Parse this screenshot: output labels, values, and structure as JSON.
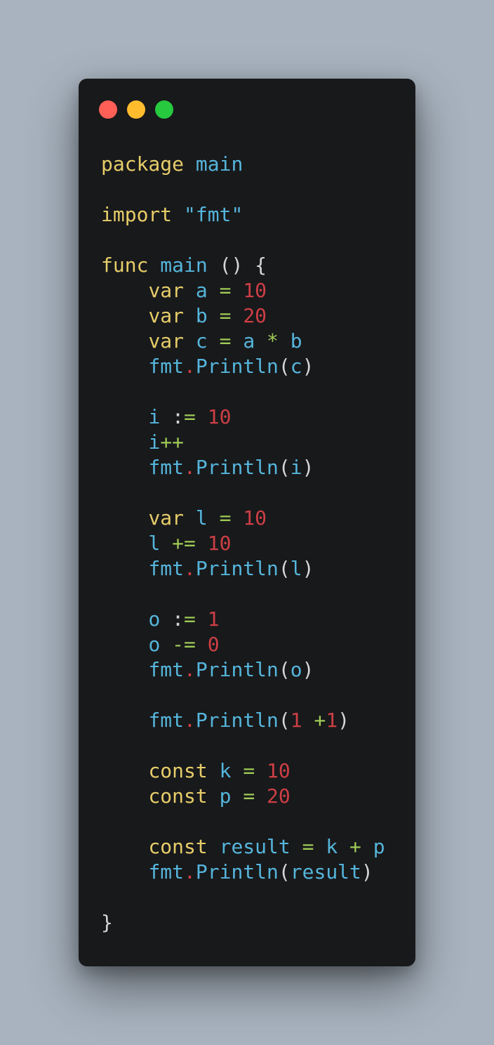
{
  "window": {
    "traffic_lights": [
      {
        "name": "close",
        "color": "#ff5f56"
      },
      {
        "name": "minimize",
        "color": "#ffbd2e"
      },
      {
        "name": "maximize",
        "color": "#27c93f"
      }
    ]
  },
  "code": {
    "language": "go",
    "lines": [
      [
        {
          "t": "package",
          "c": "kw"
        },
        {
          "t": " ",
          "c": "punc"
        },
        {
          "t": "main",
          "c": "id"
        }
      ],
      [],
      [
        {
          "t": "import",
          "c": "kw"
        },
        {
          "t": " ",
          "c": "punc"
        },
        {
          "t": "\"fmt\"",
          "c": "str"
        }
      ],
      [],
      [
        {
          "t": "func",
          "c": "kw"
        },
        {
          "t": " ",
          "c": "punc"
        },
        {
          "t": "main",
          "c": "id"
        },
        {
          "t": " () {",
          "c": "punc"
        }
      ],
      [
        {
          "t": "    ",
          "c": "punc"
        },
        {
          "t": "var",
          "c": "kw"
        },
        {
          "t": " ",
          "c": "punc"
        },
        {
          "t": "a",
          "c": "id"
        },
        {
          "t": " ",
          "c": "punc"
        },
        {
          "t": "=",
          "c": "op"
        },
        {
          "t": " ",
          "c": "punc"
        },
        {
          "t": "10",
          "c": "num"
        }
      ],
      [
        {
          "t": "    ",
          "c": "punc"
        },
        {
          "t": "var",
          "c": "kw"
        },
        {
          "t": " ",
          "c": "punc"
        },
        {
          "t": "b",
          "c": "id"
        },
        {
          "t": " ",
          "c": "punc"
        },
        {
          "t": "=",
          "c": "op"
        },
        {
          "t": " ",
          "c": "punc"
        },
        {
          "t": "20",
          "c": "num"
        }
      ],
      [
        {
          "t": "    ",
          "c": "punc"
        },
        {
          "t": "var",
          "c": "kw"
        },
        {
          "t": " ",
          "c": "punc"
        },
        {
          "t": "c",
          "c": "id"
        },
        {
          "t": " ",
          "c": "punc"
        },
        {
          "t": "=",
          "c": "op"
        },
        {
          "t": " ",
          "c": "punc"
        },
        {
          "t": "a",
          "c": "id"
        },
        {
          "t": " ",
          "c": "punc"
        },
        {
          "t": "*",
          "c": "op"
        },
        {
          "t": " ",
          "c": "punc"
        },
        {
          "t": "b",
          "c": "id"
        }
      ],
      [
        {
          "t": "    ",
          "c": "punc"
        },
        {
          "t": "fmt",
          "c": "id"
        },
        {
          "t": ".",
          "c": "dot-op"
        },
        {
          "t": "Println",
          "c": "id"
        },
        {
          "t": "(",
          "c": "punc"
        },
        {
          "t": "c",
          "c": "id"
        },
        {
          "t": ")",
          "c": "punc"
        }
      ],
      [],
      [
        {
          "t": "    ",
          "c": "punc"
        },
        {
          "t": "i",
          "c": "id"
        },
        {
          "t": " :",
          "c": "punc"
        },
        {
          "t": "=",
          "c": "op"
        },
        {
          "t": " ",
          "c": "punc"
        },
        {
          "t": "10",
          "c": "num"
        }
      ],
      [
        {
          "t": "    ",
          "c": "punc"
        },
        {
          "t": "i",
          "c": "id"
        },
        {
          "t": "++",
          "c": "op"
        }
      ],
      [
        {
          "t": "    ",
          "c": "punc"
        },
        {
          "t": "fmt",
          "c": "id"
        },
        {
          "t": ".",
          "c": "dot-op"
        },
        {
          "t": "Println",
          "c": "id"
        },
        {
          "t": "(",
          "c": "punc"
        },
        {
          "t": "i",
          "c": "id"
        },
        {
          "t": ")",
          "c": "punc"
        }
      ],
      [],
      [
        {
          "t": "    ",
          "c": "punc"
        },
        {
          "t": "var",
          "c": "kw"
        },
        {
          "t": " ",
          "c": "punc"
        },
        {
          "t": "l",
          "c": "id"
        },
        {
          "t": " ",
          "c": "punc"
        },
        {
          "t": "=",
          "c": "op"
        },
        {
          "t": " ",
          "c": "punc"
        },
        {
          "t": "10",
          "c": "num"
        }
      ],
      [
        {
          "t": "    ",
          "c": "punc"
        },
        {
          "t": "l",
          "c": "id"
        },
        {
          "t": " ",
          "c": "punc"
        },
        {
          "t": "+=",
          "c": "op"
        },
        {
          "t": " ",
          "c": "punc"
        },
        {
          "t": "10",
          "c": "num"
        }
      ],
      [
        {
          "t": "    ",
          "c": "punc"
        },
        {
          "t": "fmt",
          "c": "id"
        },
        {
          "t": ".",
          "c": "dot-op"
        },
        {
          "t": "Println",
          "c": "id"
        },
        {
          "t": "(",
          "c": "punc"
        },
        {
          "t": "l",
          "c": "id"
        },
        {
          "t": ")",
          "c": "punc"
        }
      ],
      [],
      [
        {
          "t": "    ",
          "c": "punc"
        },
        {
          "t": "o",
          "c": "id"
        },
        {
          "t": " :",
          "c": "punc"
        },
        {
          "t": "=",
          "c": "op"
        },
        {
          "t": " ",
          "c": "punc"
        },
        {
          "t": "1",
          "c": "num"
        }
      ],
      [
        {
          "t": "    ",
          "c": "punc"
        },
        {
          "t": "o",
          "c": "id"
        },
        {
          "t": " ",
          "c": "punc"
        },
        {
          "t": "-=",
          "c": "op"
        },
        {
          "t": " ",
          "c": "punc"
        },
        {
          "t": "0",
          "c": "num"
        }
      ],
      [
        {
          "t": "    ",
          "c": "punc"
        },
        {
          "t": "fmt",
          "c": "id"
        },
        {
          "t": ".",
          "c": "dot-op"
        },
        {
          "t": "Println",
          "c": "id"
        },
        {
          "t": "(",
          "c": "punc"
        },
        {
          "t": "o",
          "c": "id"
        },
        {
          "t": ")",
          "c": "punc"
        }
      ],
      [],
      [
        {
          "t": "    ",
          "c": "punc"
        },
        {
          "t": "fmt",
          "c": "id"
        },
        {
          "t": ".",
          "c": "dot-op"
        },
        {
          "t": "Println",
          "c": "id"
        },
        {
          "t": "(",
          "c": "punc"
        },
        {
          "t": "1",
          "c": "num"
        },
        {
          "t": " ",
          "c": "punc"
        },
        {
          "t": "+",
          "c": "op"
        },
        {
          "t": "1",
          "c": "num"
        },
        {
          "t": ")",
          "c": "punc"
        }
      ],
      [],
      [
        {
          "t": "    ",
          "c": "punc"
        },
        {
          "t": "const",
          "c": "kw"
        },
        {
          "t": " ",
          "c": "punc"
        },
        {
          "t": "k",
          "c": "id"
        },
        {
          "t": " ",
          "c": "punc"
        },
        {
          "t": "=",
          "c": "op"
        },
        {
          "t": " ",
          "c": "punc"
        },
        {
          "t": "10",
          "c": "num"
        }
      ],
      [
        {
          "t": "    ",
          "c": "punc"
        },
        {
          "t": "const",
          "c": "kw"
        },
        {
          "t": " ",
          "c": "punc"
        },
        {
          "t": "p",
          "c": "id"
        },
        {
          "t": " ",
          "c": "punc"
        },
        {
          "t": "=",
          "c": "op"
        },
        {
          "t": " ",
          "c": "punc"
        },
        {
          "t": "20",
          "c": "num"
        }
      ],
      [],
      [
        {
          "t": "    ",
          "c": "punc"
        },
        {
          "t": "const",
          "c": "kw"
        },
        {
          "t": " ",
          "c": "punc"
        },
        {
          "t": "result",
          "c": "id"
        },
        {
          "t": " ",
          "c": "punc"
        },
        {
          "t": "=",
          "c": "op"
        },
        {
          "t": " ",
          "c": "punc"
        },
        {
          "t": "k",
          "c": "id"
        },
        {
          "t": " ",
          "c": "punc"
        },
        {
          "t": "+",
          "c": "op"
        },
        {
          "t": " ",
          "c": "punc"
        },
        {
          "t": "p",
          "c": "id"
        }
      ],
      [
        {
          "t": "    ",
          "c": "punc"
        },
        {
          "t": "fmt",
          "c": "id"
        },
        {
          "t": ".",
          "c": "dot-op"
        },
        {
          "t": "Println",
          "c": "id"
        },
        {
          "t": "(",
          "c": "punc"
        },
        {
          "t": "result",
          "c": "id"
        },
        {
          "t": ")",
          "c": "punc"
        }
      ],
      [],
      [
        {
          "t": "}",
          "c": "punc"
        }
      ]
    ]
  }
}
